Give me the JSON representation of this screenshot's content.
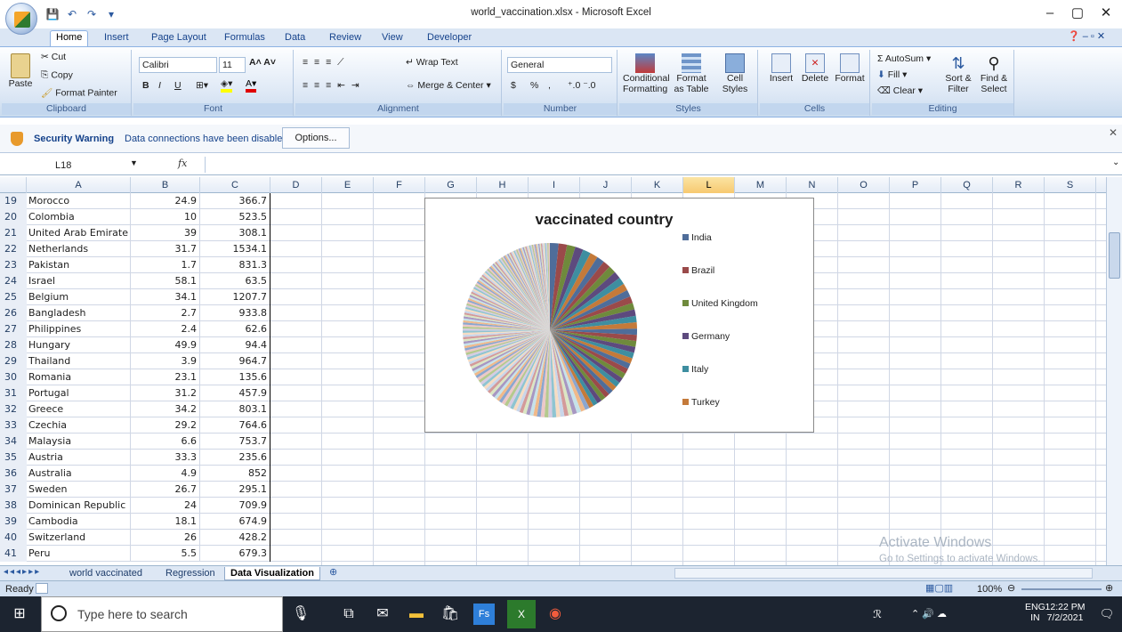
{
  "window": {
    "title": "world_vaccination.xlsx - Microsoft Excel",
    "minimize": "–",
    "maximize": "▢",
    "close": "✕"
  },
  "ribbon_tabs": [
    "Home",
    "Insert",
    "Page Layout",
    "Formulas",
    "Data",
    "Review",
    "View",
    "Developer"
  ],
  "ribbon": {
    "clipboard": {
      "paste": "Paste",
      "cut": "Cut",
      "copy": "Copy",
      "format_painter": "Format Painter",
      "label": "Clipboard"
    },
    "font": {
      "name": "Calibri",
      "size": "11",
      "bold": "B",
      "italic": "I",
      "underline": "U",
      "label": "Font"
    },
    "alignment": {
      "wrap": "Wrap Text",
      "merge": "Merge & Center",
      "label": "Alignment"
    },
    "number": {
      "format": "General",
      "currency": "$",
      "percent": "%",
      "comma": ",",
      "label": "Number"
    },
    "styles": {
      "conditional": "Conditional",
      "conditional2": "Formatting",
      "format_table": "Format",
      "format_table2": "as Table",
      "cell_styles": "Cell",
      "cell_styles2": "Styles",
      "label": "Styles"
    },
    "cells": {
      "insert": "Insert",
      "delete": "Delete",
      "format": "Format",
      "label": "Cells"
    },
    "editing": {
      "autosum": "AutoSum",
      "fill": "Fill",
      "clear": "Clear",
      "sort": "Sort &",
      "sort2": "Filter",
      "find": "Find &",
      "find2": "Select",
      "label": "Editing"
    }
  },
  "security": {
    "title": "Security Warning",
    "message": "Data connections have been disabled",
    "options": "Options..."
  },
  "formula_bar": {
    "name_box": "L18",
    "fx": "fx",
    "value": ""
  },
  "columns": [
    "A",
    "B",
    "C",
    "D",
    "E",
    "F",
    "G",
    "H",
    "I",
    "J",
    "K",
    "L",
    "M",
    "N",
    "O",
    "P",
    "Q",
    "R",
    "S"
  ],
  "selected_column": "L",
  "rows": [
    {
      "n": "19",
      "a": "Morocco",
      "b": "24.9",
      "c": "366.7"
    },
    {
      "n": "20",
      "a": "Colombia",
      "b": "10",
      "c": "523.5"
    },
    {
      "n": "21",
      "a": "United Arab Emirate",
      "b": "39",
      "c": "308.1"
    },
    {
      "n": "22",
      "a": "Netherlands",
      "b": "31.7",
      "c": "1534.1"
    },
    {
      "n": "23",
      "a": "Pakistan",
      "b": "1.7",
      "c": "831.3"
    },
    {
      "n": "24",
      "a": "Israel",
      "b": "58.1",
      "c": "63.5"
    },
    {
      "n": "25",
      "a": "Belgium",
      "b": "34.1",
      "c": "1207.7"
    },
    {
      "n": "26",
      "a": "Bangladesh",
      "b": "2.7",
      "c": "933.8"
    },
    {
      "n": "27",
      "a": "Philippines",
      "b": "2.4",
      "c": "62.6"
    },
    {
      "n": "28",
      "a": "Hungary",
      "b": "49.9",
      "c": "94.4"
    },
    {
      "n": "29",
      "a": "Thailand",
      "b": "3.9",
      "c": "964.7"
    },
    {
      "n": "30",
      "a": "Romania",
      "b": "23.1",
      "c": "135.6"
    },
    {
      "n": "31",
      "a": "Portugal",
      "b": "31.2",
      "c": "457.9"
    },
    {
      "n": "32",
      "a": "Greece",
      "b": "34.2",
      "c": "803.1"
    },
    {
      "n": "33",
      "a": "Czechia",
      "b": "29.2",
      "c": "764.6"
    },
    {
      "n": "34",
      "a": "Malaysia",
      "b": "6.6",
      "c": "753.7"
    },
    {
      "n": "35",
      "a": "Austria",
      "b": "33.3",
      "c": "235.6"
    },
    {
      "n": "36",
      "a": "Australia",
      "b": "4.9",
      "c": "852"
    },
    {
      "n": "37",
      "a": "Sweden",
      "b": "26.7",
      "c": "295.1"
    },
    {
      "n": "38",
      "a": "Dominican Republic",
      "b": "24",
      "c": "709.9"
    },
    {
      "n": "39",
      "a": "Cambodia",
      "b": "18.1",
      "c": "674.9"
    },
    {
      "n": "40",
      "a": "Switzerland",
      "b": "26",
      "c": "428.2"
    },
    {
      "n": "41",
      "a": "Peru",
      "b": "5.5",
      "c": "679.3"
    }
  ],
  "chart_data": {
    "type": "pie",
    "title": "vaccinated country",
    "legend_position": "right",
    "legend": [
      {
        "name": "India",
        "color": "#4f6d9a"
      },
      {
        "name": "Brazil",
        "color": "#9a4a4a"
      },
      {
        "name": "United Kingdom",
        "color": "#6f8a3c"
      },
      {
        "name": "Germany",
        "color": "#5d4a7e"
      },
      {
        "name": "Italy",
        "color": "#3e8ea0"
      },
      {
        "name": "Turkey",
        "color": "#c47a3a"
      }
    ]
  },
  "sheet_tabs": [
    "world vaccinated",
    "Regression",
    "Data Visualization"
  ],
  "active_sheet": "Data Visualization",
  "status": {
    "mode": "Ready",
    "zoom": "100%"
  },
  "watermark": {
    "line1": "Activate Windows",
    "line2": "Go to Settings to activate Windows."
  },
  "taskbar": {
    "search_placeholder": "Type here to search",
    "lang": "ENG",
    "region": "IN",
    "time": "12:22 PM",
    "date": "7/2/2021"
  }
}
